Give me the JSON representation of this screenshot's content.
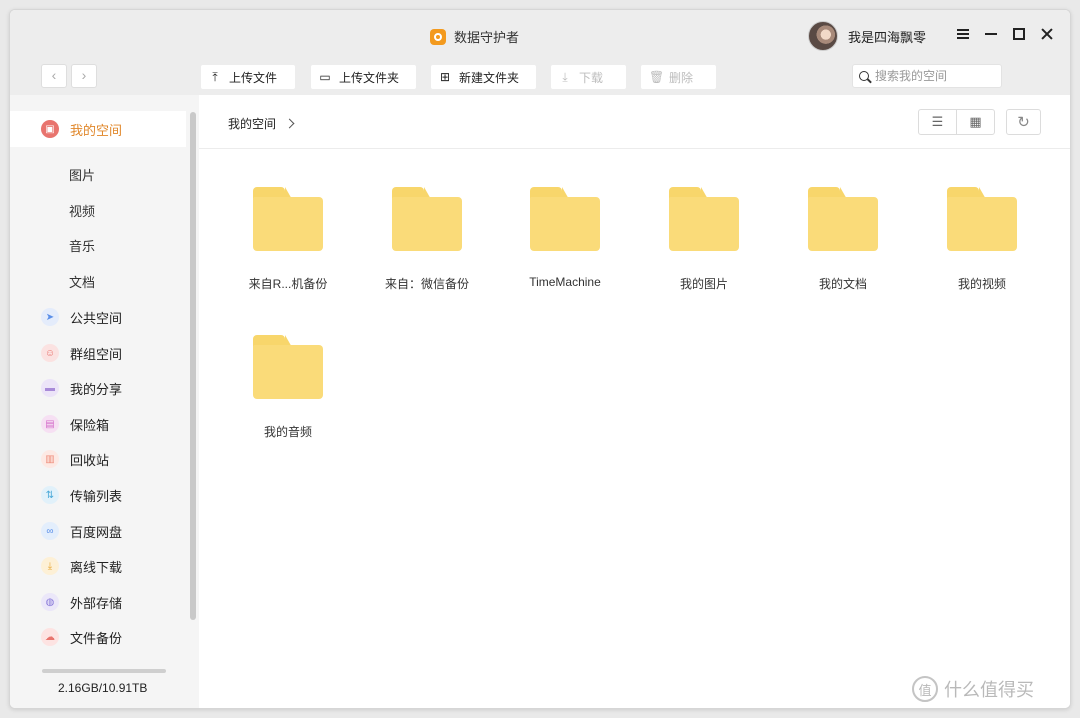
{
  "app": {
    "title": "数据守护者"
  },
  "user": {
    "name": "我是四海飘零"
  },
  "toolbar": {
    "back": "‹",
    "forward": "›",
    "upload_file": "上传文件",
    "upload_folder": "上传文件夹",
    "new_folder": "新建文件夹",
    "download": "下载",
    "delete": "删除",
    "search_placeholder": "搜索我的空间"
  },
  "sidebar": {
    "items": [
      {
        "label": "我的空间",
        "icon": "my-space-icon",
        "color": "#e8746e",
        "active": true
      },
      {
        "label": "公共空间",
        "icon": "paper-plane-icon",
        "color": "#5b8fe8"
      },
      {
        "label": "群组空间",
        "icon": "group-icon",
        "color": "#f2938f"
      },
      {
        "label": "我的分享",
        "icon": "share-icon",
        "color": "#a88ad8"
      },
      {
        "label": "保险箱",
        "icon": "safe-icon",
        "color": "#d36ac9"
      },
      {
        "label": "回收站",
        "icon": "trash-icon",
        "color": "#f3a899"
      },
      {
        "label": "传输列表",
        "icon": "transfer-icon",
        "color": "#73c1e8"
      },
      {
        "label": "百度网盘",
        "icon": "baidu-pan-icon",
        "color": "#7fb0f0"
      },
      {
        "label": "离线下载",
        "icon": "download-icon",
        "color": "#f4c15f"
      },
      {
        "label": "外部存储",
        "icon": "external-storage-icon",
        "color": "#9a8ce0"
      },
      {
        "label": "文件备份",
        "icon": "backup-icon",
        "color": "#f08a86"
      }
    ],
    "subitems": [
      "图片",
      "视频",
      "音乐",
      "文档"
    ],
    "storage": {
      "text": "2.16GB/10.91TB",
      "used_fraction": 0.0002
    }
  },
  "main": {
    "breadcrumb": "我的空间",
    "folders": [
      {
        "name": "来自R...机备份"
      },
      {
        "name": "来自：微信备份"
      },
      {
        "name": "TimeMachine"
      },
      {
        "name": "我的图片"
      },
      {
        "name": "我的文档"
      },
      {
        "name": "我的视频"
      },
      {
        "name": "我的音频"
      }
    ]
  },
  "watermark": {
    "text": "什么值得买",
    "badge": "值"
  },
  "colors": {
    "accent": "#e0872a",
    "folder": "#fadb79"
  }
}
